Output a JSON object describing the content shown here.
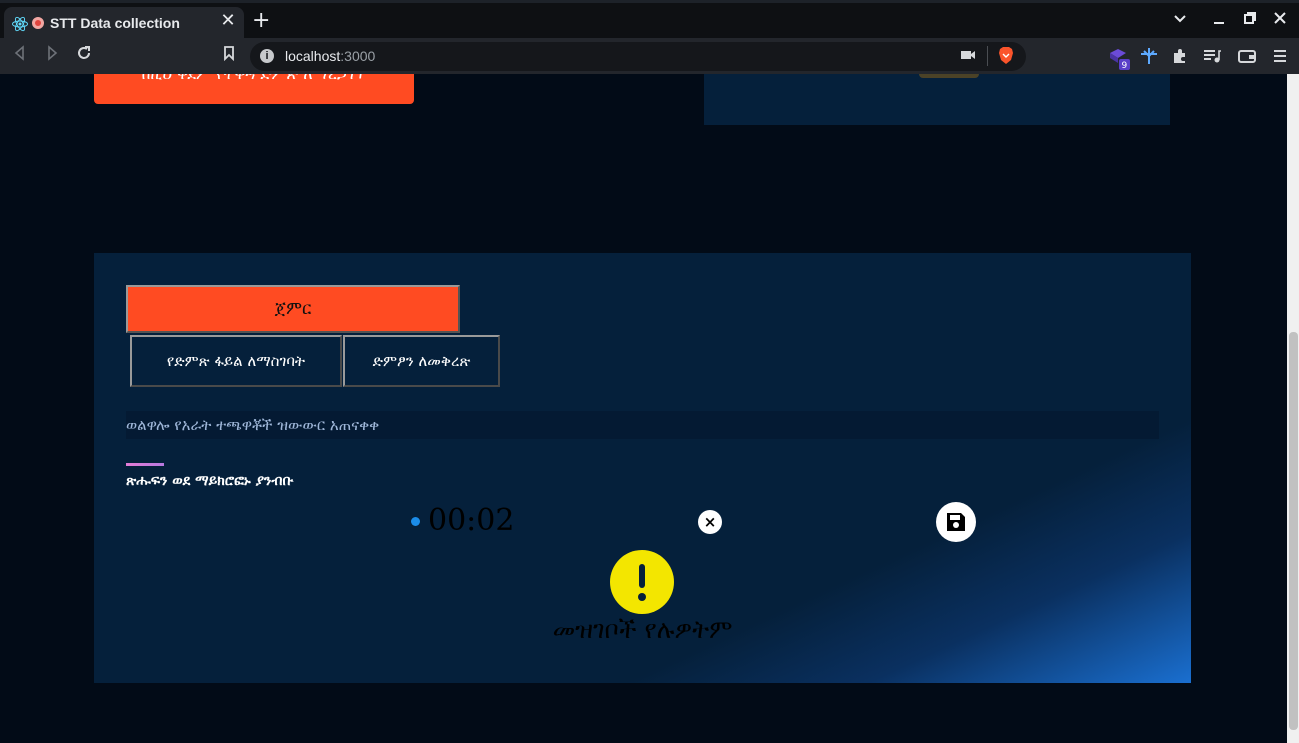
{
  "browser": {
    "tab_title": "STT Data collection",
    "tab_close": "✕",
    "new_tab": "+",
    "url_host": "localhost",
    "url_port": ":3000",
    "extension_badge": "9",
    "window_controls": [
      "⌄",
      "—",
      "❐",
      "✕"
    ]
  },
  "page": {
    "top_button_label": "ከዚህ ቀደም የተቀዳ ድምጽ ለማረጋገጥ",
    "start_button_label": "ጀምር",
    "upload_button_label": "የድምጽ ፋይል ለማስገባት",
    "verify_button_label": "ድምፆን ለመቅረጽ",
    "sentence_text": "ወልዋሎ የአራት ተጫዋቾች ዝውውር አጠናቀቀ",
    "instruction_text": "ጽሑፍን ወደ ማይክሮፎኑ ያንብቡ",
    "timer_value": "00:02",
    "cancel_symbol": "×",
    "empty_message": "መዝገቦች የሉዎትም"
  },
  "colors": {
    "accent_orange": "#ff4b22",
    "card_bg": "#05203b",
    "warning_yellow": "#f3e600",
    "recording_dot": "#1b8ce8"
  },
  "icons": [
    "react-icon",
    "recording-icon",
    "info-icon",
    "bookmark-icon",
    "camera-icon",
    "brave-icon",
    "extension-icon",
    "puzzle-icon",
    "playlist-icon",
    "wallet-icon",
    "menu-icon",
    "close-icon",
    "save-icon",
    "warning-icon"
  ]
}
